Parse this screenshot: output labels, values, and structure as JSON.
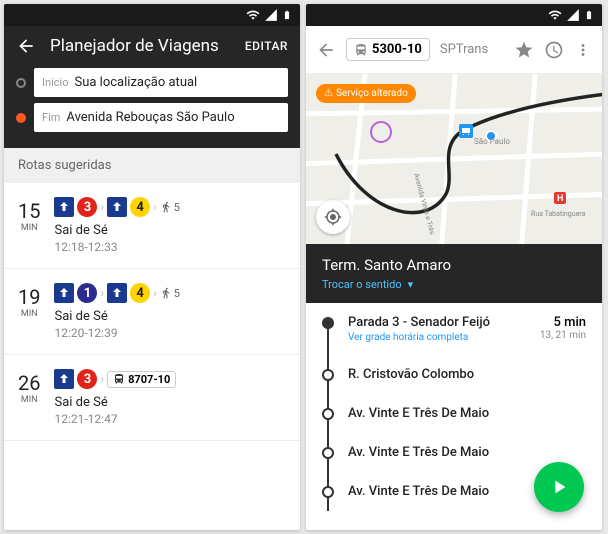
{
  "left": {
    "title": "Planejador de Viagens",
    "edit": "EDITAR",
    "start_label": "Início",
    "start_value": "Sua localização atual",
    "end_label": "Fim",
    "end_value": "Avenida Rebouças São Paulo",
    "suggested": "Rotas sugeridas",
    "routes": [
      {
        "min": "15",
        "min_label": "MIN",
        "lines": [
          "3",
          "4"
        ],
        "walk": "5",
        "from": "Sai de Sé",
        "span": "12:18-12:33"
      },
      {
        "min": "19",
        "min_label": "MIN",
        "lines": [
          "1",
          "4"
        ],
        "walk": "5",
        "from": "Sai de Sé",
        "span": "12:20-12:39"
      },
      {
        "min": "26",
        "min_label": "MIN",
        "lines": [
          "3"
        ],
        "bus": "8707-10",
        "from": "Sai de Sé",
        "span": "12:21-12:47"
      }
    ]
  },
  "right": {
    "route_id": "5300-10",
    "operator": "SPTrans",
    "map_badge": "Serviço alterado",
    "map_labels": {
      "rua": "Rua Tabatinguera"
    },
    "terminal": "Term. Santo Amaro",
    "swap": "Trocar o sentido",
    "stops": [
      {
        "name": "Parada 3 - Senador Feijó",
        "link": "Ver grade horária completa",
        "eta": "5 min",
        "eta_sub": "13, 21 min",
        "filled": true
      },
      {
        "name": "R. Cristovão Colombo"
      },
      {
        "name": "Av. Vinte E Três De Maio"
      },
      {
        "name": "Av. Vinte E Três De Maio"
      },
      {
        "name": "Av. Vinte E Três De Maio"
      }
    ]
  }
}
